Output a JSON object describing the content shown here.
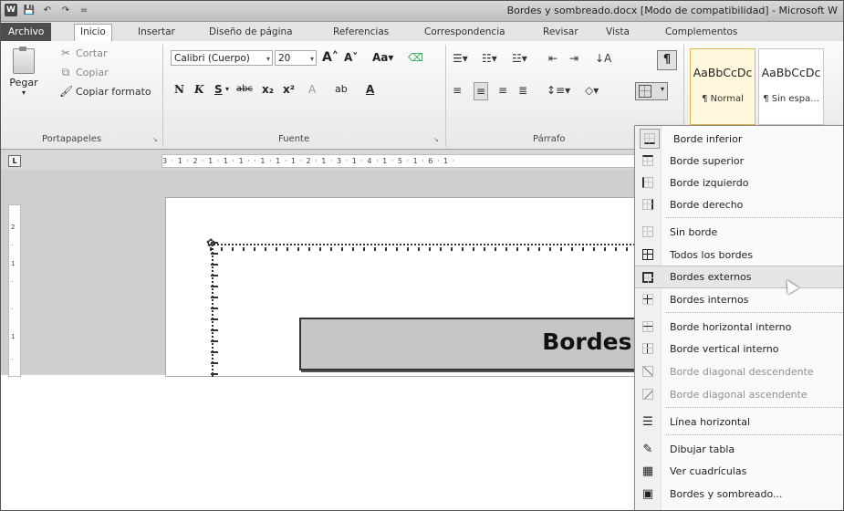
{
  "title_bar": {
    "title": "Bordes y sombreado.docx [Modo de compatibilidad] - Microsoft W",
    "qat": [
      "W",
      "💾",
      "↶",
      "↷",
      "="
    ]
  },
  "tabs": [
    "Archivo",
    "Inicio",
    "Insertar",
    "Diseño de página",
    "Referencias",
    "Correspondencia",
    "Revisar",
    "Vista",
    "Complementos"
  ],
  "active_tab": "Inicio",
  "clipboard": {
    "paste": "Pegar",
    "cut": "Cortar",
    "copy": "Copiar",
    "format_painter": "Copiar formato",
    "group": "Portapapeles"
  },
  "font": {
    "name": "Calibri (Cuerpo)",
    "size": "20",
    "group": "Fuente",
    "buttons": [
      "A˄",
      "A˅",
      "Aa▾",
      "N",
      "K",
      "S",
      "abc",
      "x₂",
      "x²",
      "A",
      "ab",
      "A"
    ]
  },
  "paragraph": {
    "group": "Párrafo",
    "pilcrow": "¶"
  },
  "styles": [
    {
      "sample": "AaBbCcDc",
      "name": "¶ Normal"
    },
    {
      "sample": "AaBbCcDc",
      "name": "¶ Sin espa..."
    }
  ],
  "ruler": {
    "corner": "L",
    "marks": "3 · 1 · 2 · 1 · 1 · 1 ·   · 1 · 1 · 1 · 2 · 1 · 3 · 1 · 4 · 1 · 5 · 1 · 6 · 1 ·"
  },
  "document": {
    "heading": "Bordes·"
  },
  "borders_menu": {
    "items": [
      {
        "label": "Borde inferior",
        "icon": "border-bottom-icon",
        "enabled": true
      },
      {
        "label": "Borde superior",
        "icon": "border-top-icon",
        "enabled": true
      },
      {
        "label": "Borde izquierdo",
        "icon": "border-left-icon",
        "enabled": true
      },
      {
        "label": "Borde derecho",
        "icon": "border-right-icon",
        "enabled": true
      },
      {
        "label": "Sin borde",
        "icon": "no-border-icon",
        "enabled": true
      },
      {
        "label": "Todos los bordes",
        "icon": "all-borders-icon",
        "enabled": true
      },
      {
        "label": "Bordes externos",
        "icon": "outside-borders-icon",
        "enabled": true,
        "highlighted": true
      },
      {
        "label": "Bordes internos",
        "icon": "inside-borders-icon",
        "enabled": true
      },
      {
        "label": "Borde horizontal interno",
        "icon": "inside-horizontal-border-icon",
        "enabled": true
      },
      {
        "label": "Borde vertical interno",
        "icon": "inside-vertical-border-icon",
        "enabled": true
      },
      {
        "label": "Borde diagonal descendente",
        "icon": "diagonal-down-border-icon",
        "enabled": false
      },
      {
        "label": "Borde diagonal ascendente",
        "icon": "diagonal-up-border-icon",
        "enabled": false
      },
      {
        "label": "Línea horizontal",
        "icon": "horizontal-line-icon",
        "enabled": true
      },
      {
        "label": "Dibujar tabla",
        "icon": "draw-table-icon",
        "enabled": true
      },
      {
        "label": "Ver cuadrículas",
        "icon": "view-gridlines-icon",
        "enabled": true
      },
      {
        "label": "Bordes y sombreado...",
        "icon": "borders-shading-icon",
        "enabled": true
      }
    ]
  }
}
